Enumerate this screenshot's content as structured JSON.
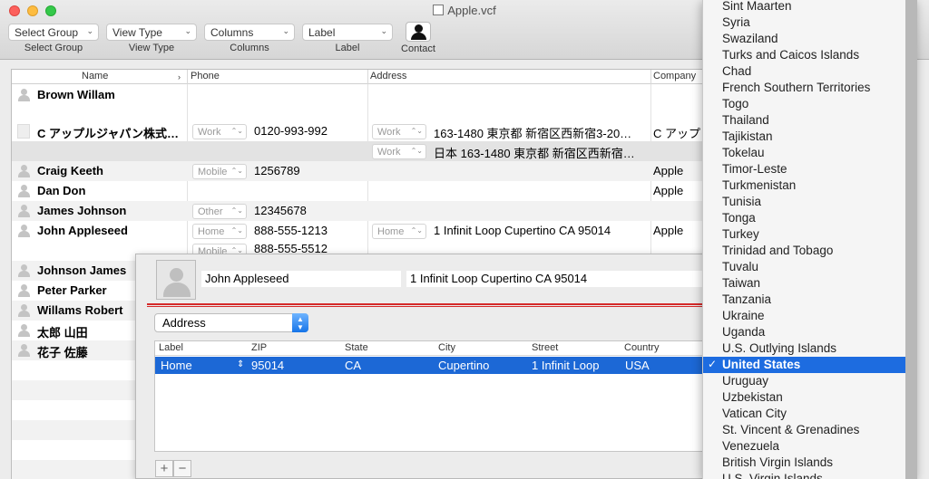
{
  "window": {
    "title": "Apple.vcf"
  },
  "toolbar": {
    "items": [
      {
        "value": "Select Group",
        "label": "Select Group"
      },
      {
        "value": "View Type",
        "label": "View Type"
      },
      {
        "value": "Columns",
        "label": "Columns"
      },
      {
        "value": "Label",
        "label": "Label"
      }
    ],
    "contact_label": "Contact"
  },
  "table": {
    "headers": [
      "Name",
      "Phone",
      "Address",
      "Company"
    ],
    "rows": [
      {
        "name": "Brown Willam"
      },
      {
        "name": "C アップルジャパン株式…",
        "phone_label": "Work",
        "phone": "0120-993-992",
        "addr_label": "Work",
        "address": "163-1480 東京都 新宿区西新宿3-20…",
        "company": "C アップ"
      },
      {
        "addr_label": "Work",
        "address": "日本 163-1480 東京都 新宿区西新宿…"
      },
      {
        "name": "Craig Keeth",
        "phone_label": "Mobile",
        "phone": "1256789",
        "company": "Apple"
      },
      {
        "name": "Dan Don",
        "company": "Apple"
      },
      {
        "name": "James Johnson",
        "phone_label": "Other",
        "phone": "12345678"
      },
      {
        "name": "John Appleseed",
        "phone_label": "Home",
        "phone": "888-555-1213",
        "addr_label": "Home",
        "address": "1 Infinit Loop Cupertino CA 95014",
        "company": "Apple"
      },
      {
        "phone_label": "Mobile",
        "phone": "888-555-5512"
      },
      {
        "name": "Johnson James"
      },
      {
        "name": "Peter Parker"
      },
      {
        "name": "Willams Robert"
      },
      {
        "name": "太郎 山田"
      },
      {
        "name": "花子 佐藤"
      }
    ]
  },
  "editor": {
    "name": "John Appleseed",
    "address": "1 Infinit Loop Cupertino CA 95014",
    "section": "Address",
    "columns": [
      "Label",
      "ZIP",
      "State",
      "City",
      "Street",
      "Country"
    ],
    "row": {
      "label": "Home",
      "zip": "95014",
      "state": "CA",
      "city": "Cupertino",
      "street": "1 Infinit Loop",
      "country": "USA"
    },
    "plus": "+",
    "minus": "−"
  },
  "country_menu": {
    "items": [
      "Sint Maarten",
      "Syria",
      "Swaziland",
      "Turks and Caicos Islands",
      "Chad",
      "French Southern Territories",
      "Togo",
      "Thailand",
      "Tajikistan",
      "Tokelau",
      "Timor-Leste",
      "Turkmenistan",
      "Tunisia",
      "Tonga",
      "Turkey",
      "Trinidad and Tobago",
      "Tuvalu",
      "Taiwan",
      "Tanzania",
      "Ukraine",
      "Uganda",
      "U.S. Outlying Islands",
      "United States",
      "Uruguay",
      "Uzbekistan",
      "Vatican City",
      "St. Vincent & Grenadines",
      "Venezuela",
      "British Virgin Islands",
      "U.S. Virgin Islands"
    ],
    "selected_index": 22,
    "check": "✓"
  }
}
